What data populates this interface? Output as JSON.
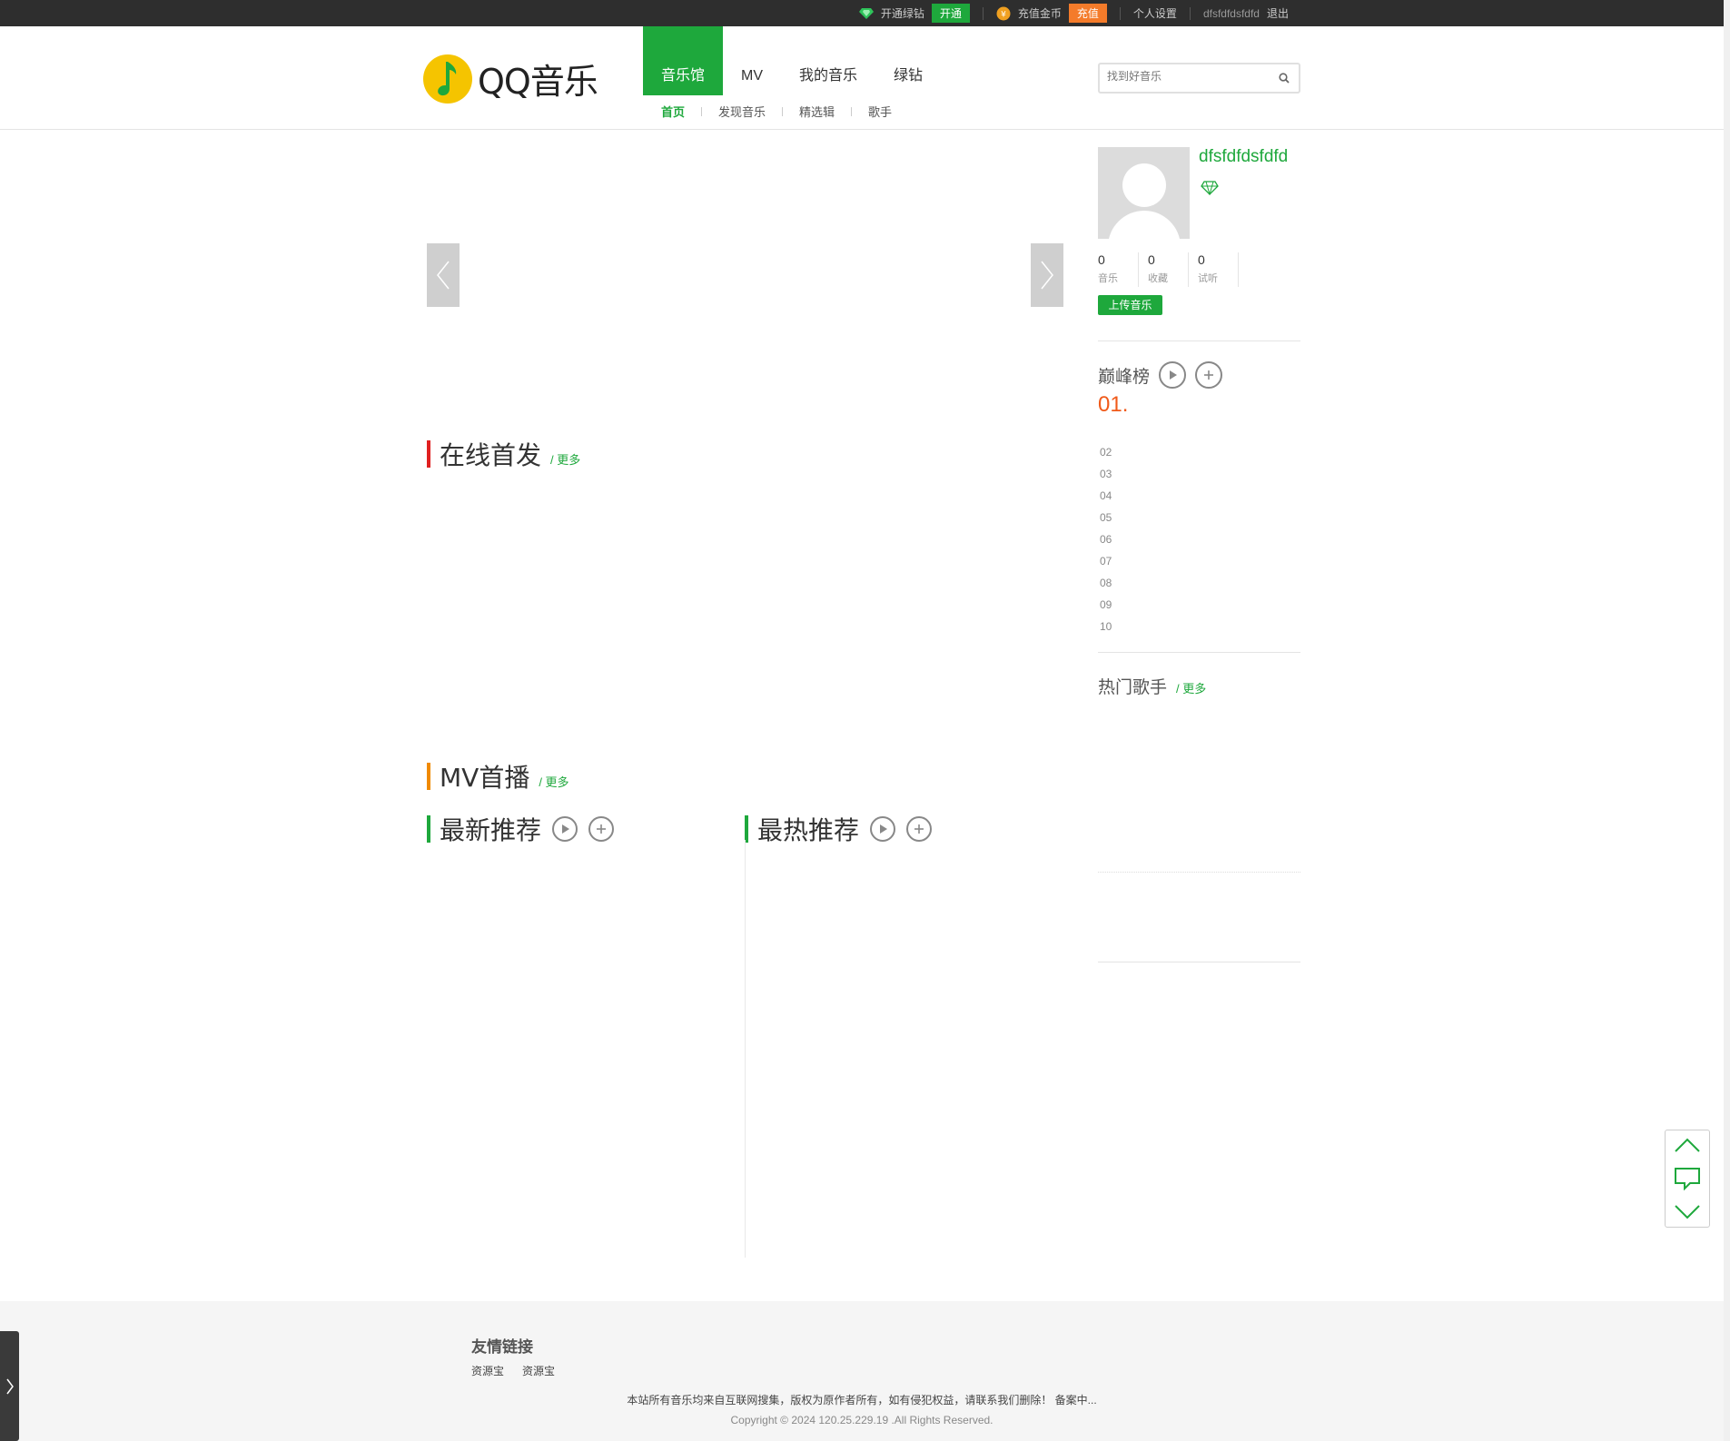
{
  "topbar": {
    "open_green_diamond": "开通绿钻",
    "open_btn": "开通",
    "recharge_coins": "充值金币",
    "recharge_btn": "充值",
    "settings": "个人设置",
    "username": "dfsfdfdsfdfd",
    "logout": "退出"
  },
  "header": {
    "logo_text": "QQ音乐",
    "nav": [
      "音乐馆",
      "MV",
      "我的音乐",
      "绿钻"
    ],
    "subnav": [
      "首页",
      "发现音乐",
      "精选辑",
      "歌手"
    ],
    "search_placeholder": "找到好音乐"
  },
  "sections": {
    "online": {
      "title": "在线首发",
      "more": "/ 更多"
    },
    "mv": {
      "title": "MV首播",
      "more": "/ 更多"
    },
    "newest": {
      "title": "最新推荐"
    },
    "hottest": {
      "title": "最热推荐"
    }
  },
  "user": {
    "name": "dfsfdfdsfdfd",
    "stats": [
      {
        "value": "0",
        "label": "音乐"
      },
      {
        "value": "0",
        "label": "收藏"
      },
      {
        "value": "0",
        "label": "试听"
      }
    ],
    "upload_label": "上传音乐"
  },
  "rank": {
    "title": "巅峰榜",
    "first": "01.",
    "items": [
      "02",
      "03",
      "04",
      "05",
      "06",
      "07",
      "08",
      "09",
      "10"
    ]
  },
  "hot_singers": {
    "title": "热门歌手",
    "more": "/ 更多"
  },
  "footer": {
    "links_title": "友情链接",
    "links": [
      "资源宝",
      "资源宝"
    ],
    "note": "本站所有音乐均来自互联网搜集，版权为原作者所有，如有侵犯权益，请联系我们删除！ 备案中...",
    "copyright": "Copyright © 2024 120.25.229.19 .All Rights Reserved."
  },
  "colors": {
    "accent_green": "#1ea83c",
    "accent_orange": "#f47b2a",
    "rank_orange": "#f05a1a",
    "mark_red": "#e02020",
    "mark_orange": "#f08a00"
  }
}
